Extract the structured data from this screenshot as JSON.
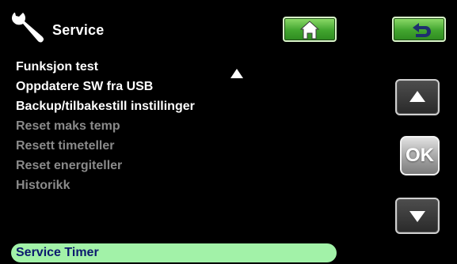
{
  "header": {
    "title": "Service",
    "icon": "wrench-icon",
    "home_icon": "home-icon",
    "back_icon": "back-arrow-icon",
    "accent_color": "#42a52f"
  },
  "menu": {
    "items": [
      {
        "label": "Funksjon test",
        "state": "enabled"
      },
      {
        "label": "Oppdatere SW fra USB",
        "state": "enabled"
      },
      {
        "label": "Backup/tilbakestill instillinger",
        "state": "enabled"
      },
      {
        "label": "Reset maks temp",
        "state": "disabled"
      },
      {
        "label": "Resett timeteller",
        "state": "disabled"
      },
      {
        "label": "Reset energiteller",
        "state": "disabled"
      },
      {
        "label": "Historikk",
        "state": "disabled"
      },
      {
        "label": "Service Timer",
        "state": "selected"
      }
    ],
    "selected_color": "#a2f2a8"
  },
  "controls": {
    "up_icon": "up-arrow-icon",
    "ok_label": "OK",
    "down_icon": "down-arrow-icon"
  }
}
